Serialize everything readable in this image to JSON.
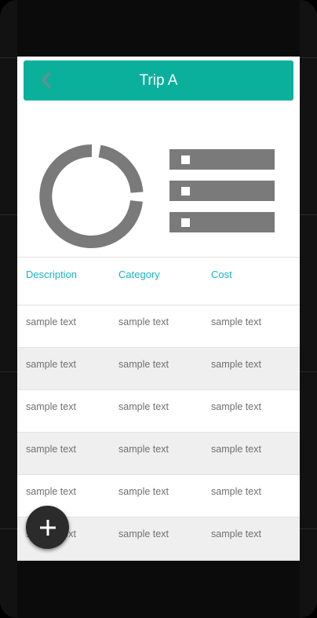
{
  "header": {
    "title": "Trip A"
  },
  "table": {
    "columns": [
      "Description",
      "Category",
      "Cost"
    ],
    "rows": [
      [
        "sample text",
        "sample text",
        "sample text"
      ],
      [
        "sample text",
        "sample text",
        "sample text"
      ],
      [
        "sample text",
        "sample text",
        "sample text"
      ],
      [
        "sample text",
        "sample text",
        "sample text"
      ],
      [
        "sample text",
        "sample text",
        "sample text"
      ],
      [
        "sample text",
        "sample text",
        "sample text"
      ]
    ]
  },
  "icons": {
    "back": "back-arrow-icon",
    "chart": "donut-chart-icon",
    "list": "list-icon",
    "add": "plus-icon"
  },
  "colors": {
    "header": "#0ab09c",
    "column_header_text": "#19b4c4",
    "fab": "#2b2b2b"
  }
}
